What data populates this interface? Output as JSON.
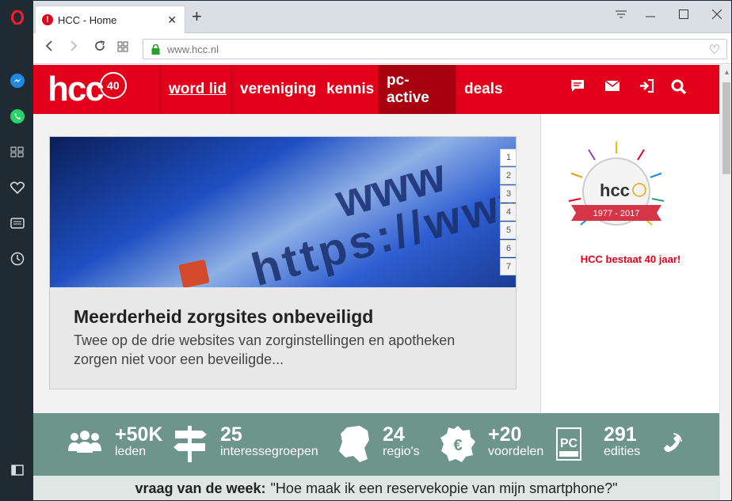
{
  "browser": {
    "tab_title": "HCC - Home",
    "tab_favicon": "!",
    "url": "www.hcc.nl",
    "new_tab": "+"
  },
  "sidebar": {
    "icons": [
      "opera-logo-icon",
      "messenger-icon",
      "whatsapp-icon",
      "speed-dial-icon",
      "heart-icon",
      "news-icon",
      "history-icon",
      "panel-toggle-icon"
    ]
  },
  "site": {
    "logo": "hcc",
    "logo_badge": "40",
    "nav": [
      {
        "label": "word lid"
      },
      {
        "label": "vereniging"
      },
      {
        "label": "kennis"
      },
      {
        "label": "pc-active"
      },
      {
        "label": "deals"
      }
    ],
    "nav_icons": [
      "chat-icon",
      "mail-icon",
      "login-icon",
      "search-icon"
    ],
    "accent": "#e2001a"
  },
  "slider": {
    "title": "Meerderheid zorgsites onbeveiligd",
    "subtitle": "Twee op de drie websites van zorginstellingen en apotheken zorgen niet voor een beveiligde...",
    "image_text": "https://www",
    "pages": [
      "1",
      "2",
      "3",
      "4",
      "5",
      "6",
      "7"
    ],
    "active_page": "1"
  },
  "aside": {
    "emblem_logo": "hcc",
    "emblem_years": "1977 - 2017",
    "caption": "HCC bestaat 40 jaar!"
  },
  "stats": [
    {
      "num": "+50K",
      "label": "leden",
      "icon": "people-icon"
    },
    {
      "num": "25",
      "label": "interessegroepen",
      "icon": "signpost-icon"
    },
    {
      "num": "24",
      "label": "regio's",
      "icon": "netherlands-map-icon"
    },
    {
      "num": "+20",
      "label": "voordelen",
      "icon": "euro-badge-icon"
    },
    {
      "num": "291",
      "label": "edities",
      "icon": "pc-active-icon"
    }
  ],
  "question": {
    "prefix": "vraag van de week:",
    "text": "\"Hoe maak ik een reservekopie van mijn smartphone?\""
  }
}
